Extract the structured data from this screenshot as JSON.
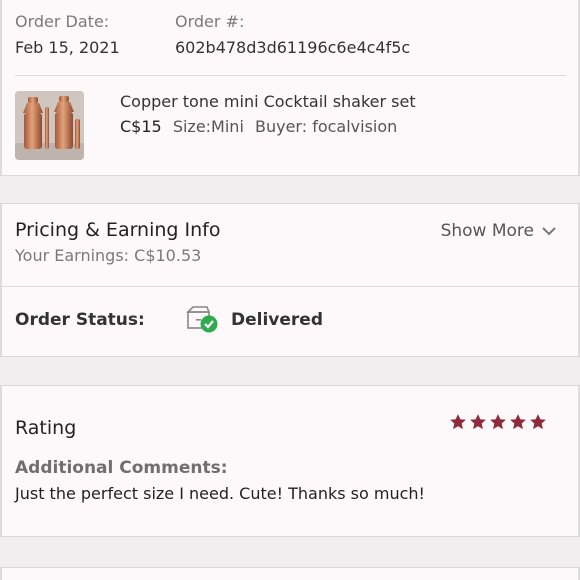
{
  "order": {
    "date_label": "Order Date:",
    "date_value": "Feb 15, 2021",
    "number_label": "Order #:",
    "number_value": "602b478d3d61196c6e4c4f5c"
  },
  "item": {
    "thumbnail_icon": "cocktail-shaker-photo",
    "title": "Copper tone mini Cocktail shaker set",
    "price": "C$15",
    "size": "Size:Mini",
    "buyer": "Buyer: focalvision"
  },
  "pricing": {
    "title": "Pricing & Earning Info",
    "earnings": "Your Earnings: C$10.53",
    "show_more": "Show More"
  },
  "status": {
    "label": "Order Status:",
    "value": "Delivered",
    "icon": "delivered-box-check-icon",
    "check_color": "#2eab4f"
  },
  "rating": {
    "title": "Rating",
    "stars": 5,
    "star_color": "#8e2a3b",
    "comments_label": "Additional Comments:",
    "comments_text": "Just the perfect size I need. Cute! Thanks so much!"
  },
  "colors": {
    "background": "#fdf9fa",
    "band": "#f1eef0",
    "divider": "#d9d9d9"
  }
}
